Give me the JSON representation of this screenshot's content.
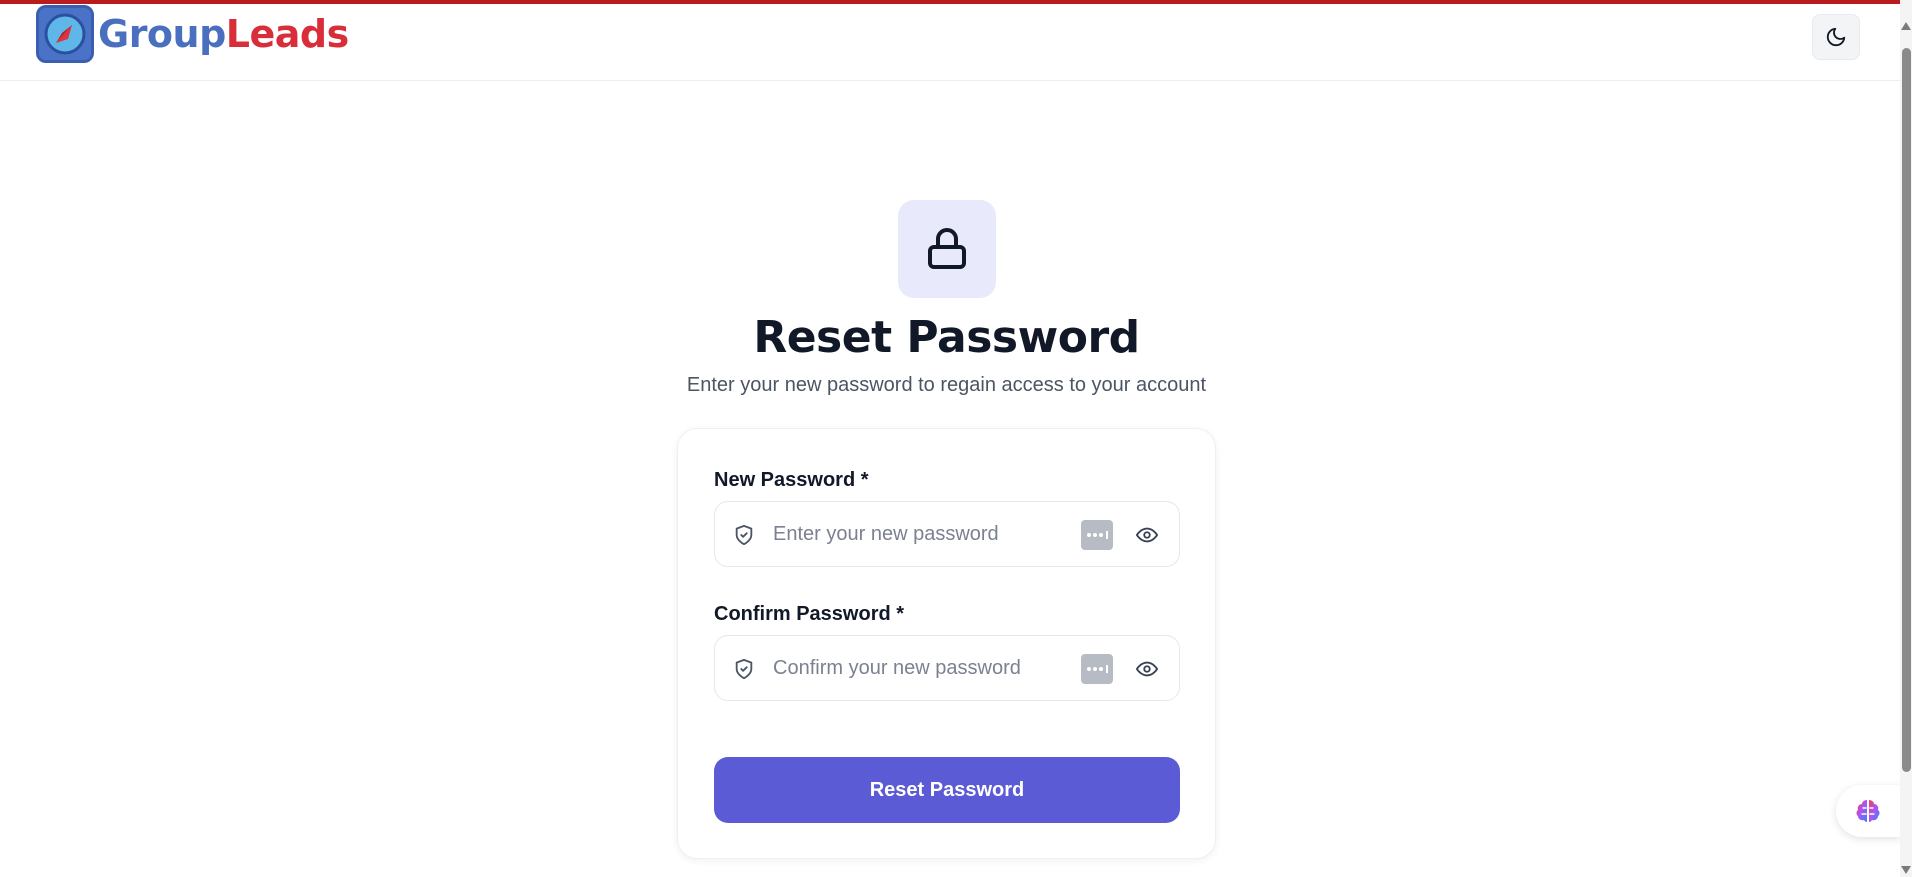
{
  "brand": {
    "name_part1": "Group",
    "name_part2": "Leads",
    "accent": "#d92d3a",
    "primary": "#4a6fbf"
  },
  "header": {
    "theme_toggle_icon": "moon-icon"
  },
  "hero": {
    "icon": "lock-icon",
    "title": "Reset Password",
    "subtitle": "Enter your new password to regain access to your account"
  },
  "form": {
    "new_password": {
      "label": "New Password *",
      "placeholder": "Enter your new password",
      "value": ""
    },
    "confirm_password": {
      "label": "Confirm Password *",
      "placeholder": "Confirm your new password",
      "value": ""
    },
    "submit_label": "Reset Password"
  },
  "colors": {
    "button": "#5b5bd6",
    "lock_tile": "#e8e9fb",
    "top_accent": "#b91c1c"
  }
}
